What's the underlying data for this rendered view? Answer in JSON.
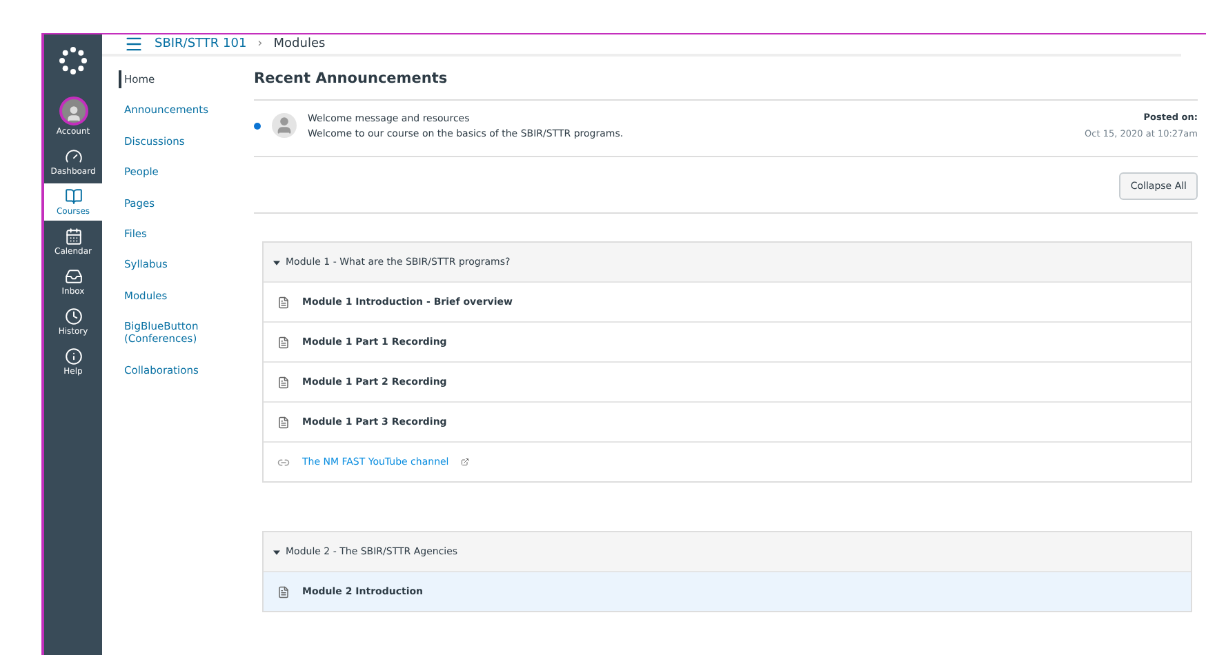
{
  "global_nav": [
    {
      "kind": "account",
      "label": "Account",
      "selected": false
    },
    {
      "kind": "dashboard",
      "label": "Dashboard",
      "selected": false
    },
    {
      "kind": "courses",
      "label": "Courses",
      "selected": true
    },
    {
      "kind": "calendar",
      "label": "Calendar",
      "selected": false
    },
    {
      "kind": "inbox",
      "label": "Inbox",
      "selected": false
    },
    {
      "kind": "history",
      "label": "History",
      "selected": false
    },
    {
      "kind": "help",
      "label": "Help",
      "selected": false
    }
  ],
  "breadcrumb": {
    "course": "SBIR/STTR 101",
    "separator": "›",
    "page": "Modules"
  },
  "course_nav": [
    {
      "label": "Home",
      "selected": true
    },
    {
      "label": "Announcements",
      "selected": false
    },
    {
      "label": "Discussions",
      "selected": false
    },
    {
      "label": "People",
      "selected": false
    },
    {
      "label": "Pages",
      "selected": false
    },
    {
      "label": "Files",
      "selected": false
    },
    {
      "label": "Syllabus",
      "selected": false
    },
    {
      "label": "Modules",
      "selected": false
    },
    {
      "label": "BigBlueButton (Conferences)",
      "selected": false
    },
    {
      "label": "Collaborations",
      "selected": false
    }
  ],
  "announcements": {
    "title": "Recent Announcements",
    "items": [
      {
        "unread": true,
        "title": "Welcome message and resources",
        "message": "Welcome to our course on the basics of the SBIR/STTR programs.",
        "posted_label": "Posted on:",
        "posted_date": "Oct 15, 2020 at 10:27am"
      }
    ]
  },
  "collapse_button": "Collapse All",
  "modules": [
    {
      "title": "Module 1 - What are the SBIR/STTR programs?",
      "expanded": true,
      "items": [
        {
          "kind": "page",
          "title": "Module 1 Introduction - Brief overview",
          "selected": false
        },
        {
          "kind": "page",
          "title": "Module 1 Part 1 Recording",
          "selected": false
        },
        {
          "kind": "page",
          "title": "Module 1 Part 2 Recording",
          "selected": false
        },
        {
          "kind": "page",
          "title": "Module 1 Part 3 Recording",
          "selected": false
        },
        {
          "kind": "link",
          "title": "The NM FAST YouTube channel",
          "selected": false
        }
      ]
    },
    {
      "title": "Module 2 - The SBIR/STTR Agencies",
      "expanded": true,
      "items": [
        {
          "kind": "page",
          "title": "Module 2 Introduction",
          "selected": true
        }
      ]
    }
  ]
}
